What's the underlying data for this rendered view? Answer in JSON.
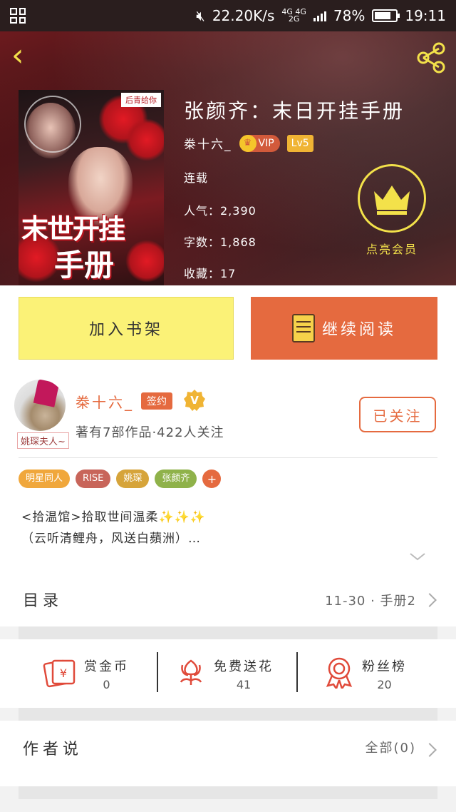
{
  "statusbar": {
    "speed": "22.20K/s",
    "net_top": "4G 4G",
    "net_bottom": "2G",
    "battery": "78%",
    "battery_level": 0.78,
    "time": "19:11"
  },
  "book": {
    "title": "张颜齐：末日开挂手册",
    "author": "桊十六_",
    "vip_label": "VIP",
    "level": "Lv5",
    "status": "连载",
    "popularity": "人气：2,390",
    "word_count": "字数：1,868",
    "favorites": "收藏：17",
    "cover": {
      "tag": "后青给你",
      "title_line1": "末世开挂",
      "title_line2": "手册"
    },
    "member_label": "点亮会员"
  },
  "actions": {
    "add_shelf": "加入书架",
    "continue_read": "继续阅读"
  },
  "author_panel": {
    "avatar_caption": "姚琛夫人~",
    "name": "桊十六_",
    "signed_label": "签约",
    "stats": "著有7部作品·422人关注",
    "follow_label": "已关注"
  },
  "tags": [
    {
      "label": "明星同人",
      "color": "#f0a73c"
    },
    {
      "label": "RISE",
      "color": "#c8655a"
    },
    {
      "label": "姚琛",
      "color": "#d6a43a"
    },
    {
      "label": "张颜齐",
      "color": "#8fb24a"
    }
  ],
  "tag_plus": "+",
  "intro": {
    "line1": "<拾温馆>拾取世间温柔✨✨✨",
    "line2": "（云听清鲤舟，风送白蘋洲）…"
  },
  "toc": {
    "label": "目录",
    "value": "11-30 · 手册2"
  },
  "stats": [
    {
      "label": "赏金币",
      "value": "0",
      "icon": "red-envelope-icon"
    },
    {
      "label": "免费送花",
      "value": "41",
      "icon": "flower-icon"
    },
    {
      "label": "粉丝榜",
      "value": "20",
      "icon": "medal-icon"
    }
  ],
  "author_says": {
    "label": "作者说",
    "value": "全部(0)"
  },
  "colors": {
    "accent": "#e56a3f",
    "shelf_button": "#fbf277",
    "member_yellow": "#f3e14a"
  }
}
